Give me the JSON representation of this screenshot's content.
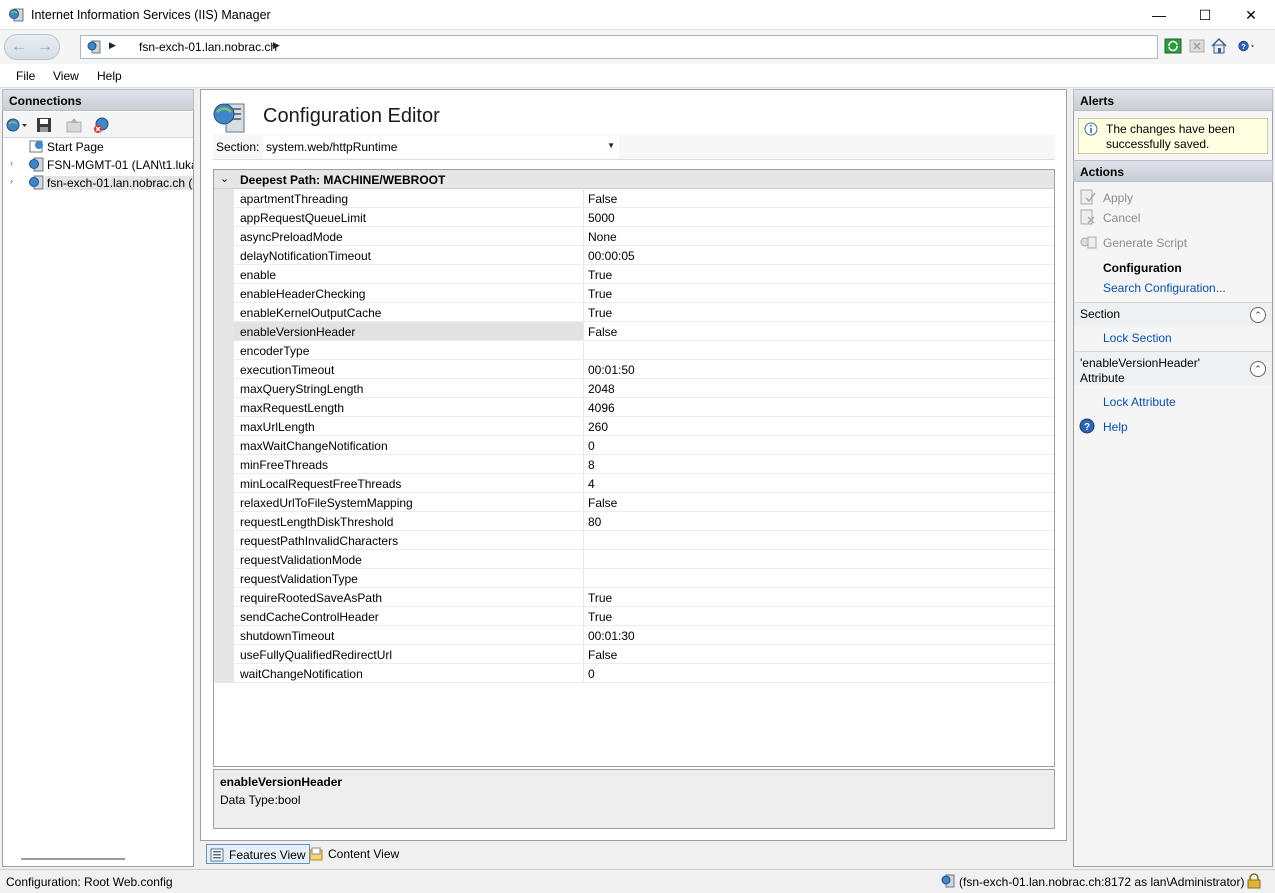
{
  "window": {
    "title": "Internet Information Services (IIS) Manager",
    "min_glyph": "—",
    "max_glyph": "☐",
    "close_glyph": "✕"
  },
  "address": {
    "breadcrumb": "fsn-exch-01.lan.nobrac.ch",
    "nav_back": "←",
    "nav_forward": "→"
  },
  "menu": [
    "File",
    "View",
    "Help"
  ],
  "connections": {
    "title": "Connections",
    "tree": [
      {
        "label": "Start Page",
        "expander": "",
        "icon": "start-page-icon",
        "selected": false
      },
      {
        "label": "FSN-MGMT-01 (LAN\\t1.luka",
        "expander": "›",
        "icon": "server-icon",
        "selected": false
      },
      {
        "label": "fsn-exch-01.lan.nobrac.ch (l",
        "expander": "›",
        "icon": "server-icon",
        "selected": true
      }
    ]
  },
  "main": {
    "title": "Configuration Editor",
    "section_label": "Section:",
    "section_value": "system.web/httpRuntime",
    "group_chevron": "⌄",
    "group_header": "Deepest Path: MACHINE/WEBROOT",
    "rows": [
      {
        "name": "apartmentThreading",
        "value": "False"
      },
      {
        "name": "appRequestQueueLimit",
        "value": "5000"
      },
      {
        "name": "asyncPreloadMode",
        "value": "None"
      },
      {
        "name": "delayNotificationTimeout",
        "value": "00:00:05"
      },
      {
        "name": "enable",
        "value": "True"
      },
      {
        "name": "enableHeaderChecking",
        "value": "True"
      },
      {
        "name": "enableKernelOutputCache",
        "value": "True"
      },
      {
        "name": "enableVersionHeader",
        "value": "False"
      },
      {
        "name": "encoderType",
        "value": ""
      },
      {
        "name": "executionTimeout",
        "value": "00:01:50"
      },
      {
        "name": "maxQueryStringLength",
        "value": "2048"
      },
      {
        "name": "maxRequestLength",
        "value": "4096"
      },
      {
        "name": "maxUrlLength",
        "value": "260"
      },
      {
        "name": "maxWaitChangeNotification",
        "value": "0"
      },
      {
        "name": "minFreeThreads",
        "value": "8"
      },
      {
        "name": "minLocalRequestFreeThreads",
        "value": "4"
      },
      {
        "name": "relaxedUrlToFileSystemMapping",
        "value": "False"
      },
      {
        "name": "requestLengthDiskThreshold",
        "value": "80"
      },
      {
        "name": "requestPathInvalidCharacters",
        "value": ""
      },
      {
        "name": "requestValidationMode",
        "value": ""
      },
      {
        "name": "requestValidationType",
        "value": ""
      },
      {
        "name": "requireRootedSaveAsPath",
        "value": "True"
      },
      {
        "name": "sendCacheControlHeader",
        "value": "True"
      },
      {
        "name": "shutdownTimeout",
        "value": "00:01:30"
      },
      {
        "name": "useFullyQualifiedRedirectUrl",
        "value": "False"
      },
      {
        "name": "waitChangeNotification",
        "value": "0"
      }
    ],
    "selected_row": "enableVersionHeader",
    "description": {
      "title": "enableVersionHeader",
      "data_type": "Data Type:bool"
    },
    "views": {
      "features": "Features View",
      "content": "Content View"
    }
  },
  "alerts": {
    "title": "Alerts",
    "message": "The changes have been successfully saved."
  },
  "actions": {
    "title": "Actions",
    "apply": "Apply",
    "cancel": "Cancel",
    "generate_script": "Generate Script",
    "configuration": "Configuration",
    "search_configuration": "Search Configuration...",
    "section_head": "Section",
    "lock_section": "Lock Section",
    "attribute_head": "'enableVersionHeader' Attribute",
    "lock_attribute": "Lock Attribute",
    "help": "Help",
    "collapse_glyph": "⌃"
  },
  "status": {
    "left": "Configuration: Root Web.config",
    "right": "(fsn-exch-01.lan.nobrac.ch:8172 as lan\\Administrator)"
  }
}
